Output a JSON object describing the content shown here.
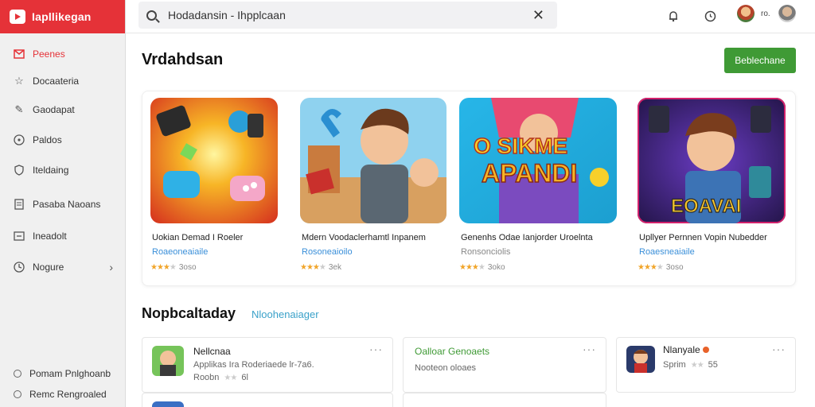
{
  "brand": {
    "name": "Iapllikegan"
  },
  "sidebar": {
    "items": [
      {
        "label": "Peenes",
        "icon": "inbox-icon"
      },
      {
        "label": "Docaateria",
        "icon": "star-icon"
      },
      {
        "label": "Gaodapat",
        "icon": "pencil-icon"
      },
      {
        "label": "Paldos",
        "icon": "compass-icon"
      },
      {
        "label": "Iteldaing",
        "icon": "shield-icon"
      },
      {
        "label": "Pasaba Naoans",
        "icon": "document-icon"
      },
      {
        "label": "Ineadolt",
        "icon": "download-icon"
      },
      {
        "label": "Nogure",
        "icon": "clock-icon"
      }
    ],
    "footer": [
      {
        "label": "Pomam Pnlghoanb"
      },
      {
        "label": "Remc Rengroaled"
      }
    ]
  },
  "topbar": {
    "search_value": "Hodadansin - Ihpplcaan",
    "clear_label": "✕",
    "user_text": "ro."
  },
  "main": {
    "title": "Vrdahdsan",
    "primary_button": "Beblechane",
    "featured": [
      {
        "title": "Uokian Demad I Roeler",
        "subtitle": "Roaeoneaiaile",
        "rating": "3oso"
      },
      {
        "title": "Mdern Voodaclerhamtl Inpanem",
        "subtitle": "Rosoneaioilo",
        "rating": "3ek"
      },
      {
        "title": "Genenhs Odae Ianjorder Uroelnta",
        "subtitle": "Ronsonciolis",
        "rating": "3oko"
      },
      {
        "title": "Upllyer Pernnen Vopin Nubedder",
        "subtitle": "Roaesneaiaile",
        "rating": "3oso"
      }
    ],
    "section2_title": "Nopbcaltaday",
    "section2_link": "Nloohenaiager",
    "list": [
      {
        "title": "Nellcnaa",
        "desc1": "Applikas Ira Roderiaede lr-7a6.",
        "desc2": "Roobn",
        "rating": "6l",
        "more": "···"
      },
      {
        "title": "Oalloar Genoaets",
        "desc1": "Nooteon oloaes",
        "more": "···"
      },
      {
        "title": "Nlanyale",
        "desc1": "Sprim",
        "rating": "55",
        "more": "···"
      }
    ]
  },
  "colors": {
    "brand": "#e53238",
    "primary_button": "#3f9a35",
    "link": "#3aa1c9",
    "star": "#f1a52a"
  }
}
